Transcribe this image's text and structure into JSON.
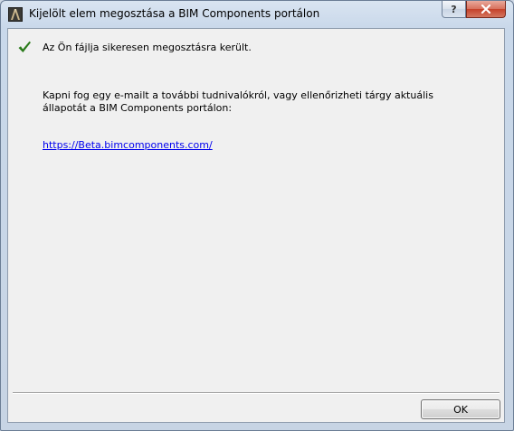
{
  "window": {
    "title": "Kijelölt elem megosztása a BIM Components portálon",
    "help_label": "?",
    "close_icon": "close-icon",
    "app_icon": "archicad-app-icon"
  },
  "content": {
    "success_icon": "checkmark-icon",
    "success_color": "#2a7a1a",
    "success_message": "Az Ön fájlja sikeresen megosztásra került.",
    "info_message": "Kapni fog egy e-mailt a további tudnivalókról, vagy ellenőrizheti tárgy aktuális állapotát a BIM Components portálon:",
    "link_text": "https://Beta.bimcomponents.com/"
  },
  "footer": {
    "ok_label": "OK"
  }
}
